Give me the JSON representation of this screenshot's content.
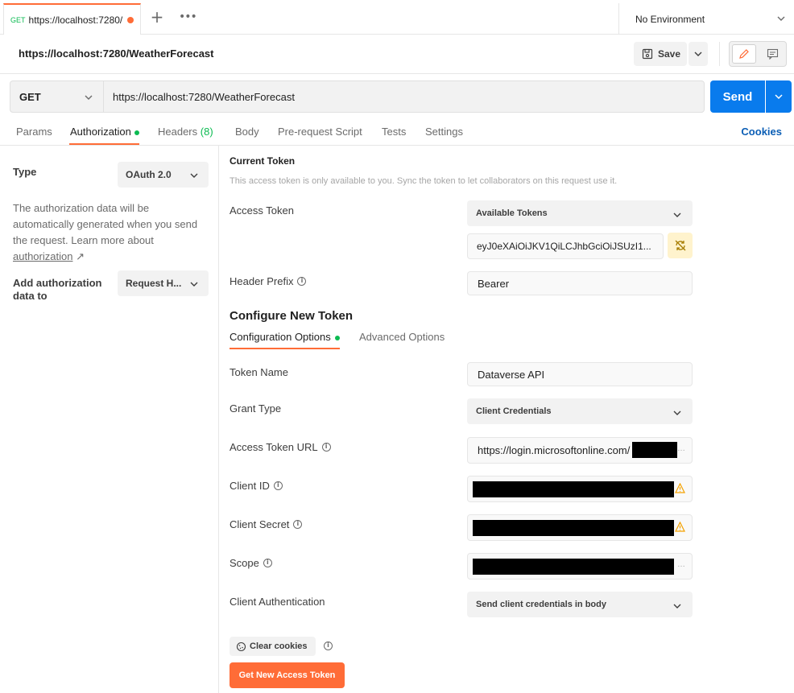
{
  "tabbar": {
    "tab_method": "GET",
    "tab_title": "https://localhost:7280/",
    "environment": "No Environment"
  },
  "header": {
    "title": "https://localhost:7280/WeatherForecast",
    "save_label": "Save"
  },
  "request": {
    "method": "GET",
    "url": "https://localhost:7280/WeatherForecast",
    "send_label": "Send"
  },
  "tabs": {
    "params": "Params",
    "authorization": "Authorization",
    "headers": "Headers",
    "headers_count": "(8)",
    "body": "Body",
    "prerequest": "Pre-request Script",
    "tests": "Tests",
    "settings": "Settings",
    "cookies": "Cookies"
  },
  "auth_left": {
    "type_label": "Type",
    "type_value": "OAuth 2.0",
    "description": "The authorization data will be automatically generated when you send the request. Learn more about",
    "link_text": "authorization",
    "link_arrow": "↗",
    "add_to_label": "Add authorization data to",
    "add_to_value": "Request H..."
  },
  "current_token": {
    "title": "Current Token",
    "note": "This access token is only available to you. Sync the token to let collaborators on this request use it.",
    "access_token_label": "Access Token",
    "available_tokens": "Available Tokens",
    "token_value": "eyJ0eXAiOiJKV1QiLCJhbGciOiJSUzI1...",
    "header_prefix_label": "Header Prefix",
    "header_prefix_value": "Bearer"
  },
  "configure": {
    "title": "Configure New Token",
    "tab_config": "Configuration Options",
    "tab_advanced": "Advanced Options",
    "token_name_label": "Token Name",
    "token_name_value": "Dataverse API",
    "grant_type_label": "Grant Type",
    "grant_type_value": "Client Credentials",
    "access_token_url_label": "Access Token URL",
    "access_token_url_value": "https://login.microsoftonline.com/",
    "client_id_label": "Client ID",
    "client_secret_label": "Client Secret",
    "scope_label": "Scope",
    "client_auth_label": "Client Authentication",
    "client_auth_value": "Send client credentials in body",
    "clear_cookies": "Clear cookies",
    "get_token": "Get New Access Token"
  },
  "colors": {
    "accent": "#ff6c37",
    "primary": "#097bed",
    "success": "#0cbb52",
    "warning": "#f4a200"
  }
}
